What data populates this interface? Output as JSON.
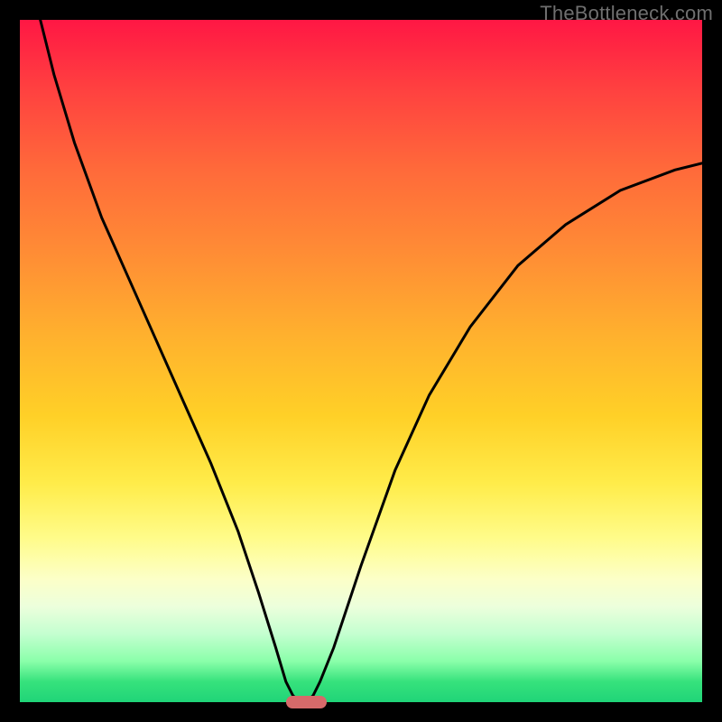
{
  "watermark": "TheBottleneck.com",
  "chart_data": {
    "type": "line",
    "title": "",
    "xlabel": "",
    "ylabel": "",
    "xlim": [
      0,
      100
    ],
    "ylim": [
      0,
      100
    ],
    "series": [
      {
        "name": "bottleneck-curve",
        "x": [
          3,
          5,
          8,
          12,
          16,
          20,
          24,
          28,
          32,
          35,
          37.5,
          39,
          40,
          41,
          42,
          43,
          44,
          46,
          50,
          55,
          60,
          66,
          73,
          80,
          88,
          96,
          100
        ],
        "y": [
          100,
          92,
          82,
          71,
          62,
          53,
          44,
          35,
          25,
          16,
          8,
          3,
          1,
          0,
          0,
          1,
          3,
          8,
          20,
          34,
          45,
          55,
          64,
          70,
          75,
          78,
          79
        ]
      }
    ],
    "minimum_marker": {
      "x_start": 39,
      "x_end": 45,
      "y": 0
    },
    "colors": {
      "gradient_top": "#ff1744",
      "gradient_bottom": "#20d478",
      "curve": "#000000",
      "marker": "#d66a6a",
      "frame": "#000000"
    }
  }
}
